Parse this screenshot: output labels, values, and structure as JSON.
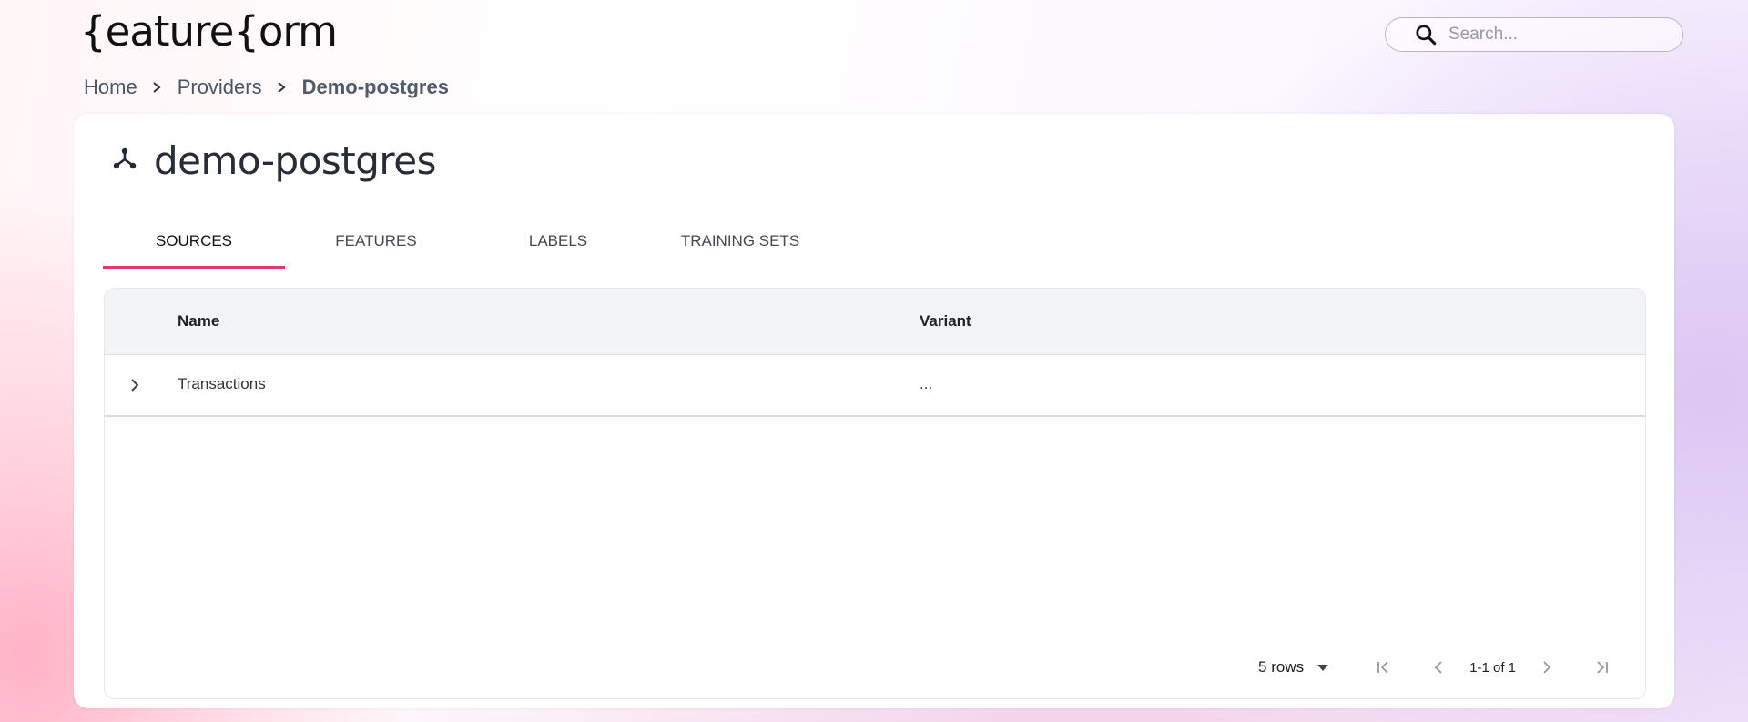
{
  "brand": {
    "logo_text": "{eature{orm"
  },
  "search": {
    "placeholder": "Search..."
  },
  "breadcrumb": {
    "items": [
      "Home",
      "Providers"
    ],
    "current": "Demo-postgres"
  },
  "page": {
    "title": "demo-postgres",
    "icon": "provider-icon"
  },
  "tabs": [
    {
      "label": "Sources",
      "active": true
    },
    {
      "label": "Features",
      "active": false
    },
    {
      "label": "Labels",
      "active": false
    },
    {
      "label": "Training Sets",
      "active": false
    }
  ],
  "table": {
    "columns": [
      "Name",
      "Variant"
    ],
    "rows": [
      {
        "name": "Transactions",
        "variant": "..."
      }
    ]
  },
  "pagination": {
    "rows_label": "5 rows",
    "range": "1-1 of 1"
  },
  "colors": {
    "accent": "#e8336d",
    "header_bg": "#f3f4f6"
  }
}
